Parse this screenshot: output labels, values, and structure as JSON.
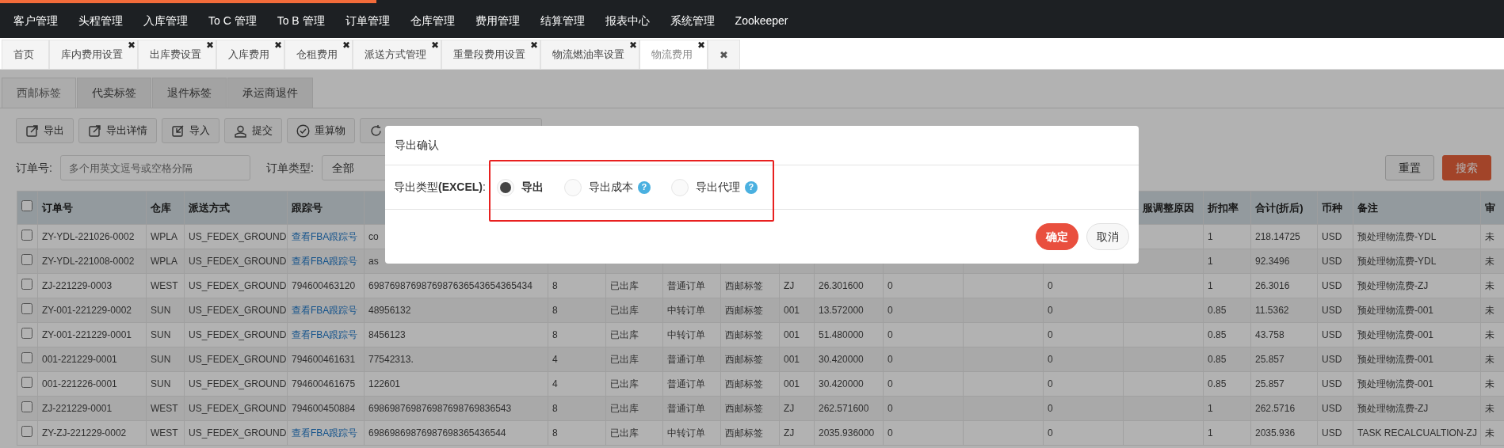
{
  "loading_bar": {
    "level": 0.25
  },
  "top_nav": {
    "items": [
      "客户管理",
      "头程管理",
      "入库管理",
      "To C 管理",
      "To B 管理",
      "订单管理",
      "仓库管理",
      "费用管理",
      "结算管理",
      "报表中心",
      "系统管理",
      "Zookeeper"
    ]
  },
  "page_tabs": [
    {
      "label": "首页",
      "selected": false
    },
    {
      "label": "库内费用设置",
      "selected": false,
      "close": "✖"
    },
    {
      "label": "出库费设置",
      "selected": false,
      "close": "✖"
    },
    {
      "label": "入库费用",
      "selected": false,
      "close": "✖"
    },
    {
      "label": "仓租费用",
      "selected": false,
      "close": "✖"
    },
    {
      "label": "派送方式管理",
      "selected": false,
      "close": "✖"
    },
    {
      "label": "重量段费用设置",
      "selected": false,
      "close": "✖"
    },
    {
      "label": "物流燃油率设置",
      "selected": false,
      "close": "✖"
    },
    {
      "label": "物流费用",
      "selected": true,
      "close": "✖"
    },
    {
      "close": "✖"
    }
  ],
  "sub_tabs": [
    {
      "label": "西邮标签",
      "selected": true
    },
    {
      "label": "代卖标签",
      "selected": false
    },
    {
      "label": "退件标签",
      "selected": false
    },
    {
      "label": "承运商退件",
      "selected": false
    }
  ],
  "toolbar": [
    {
      "label": "导出",
      "kind": "export"
    },
    {
      "label": "导出详情",
      "kind": "export"
    },
    {
      "label": "导入",
      "kind": "import"
    },
    {
      "label": "提交",
      "kind": "user"
    },
    {
      "label": "重算物",
      "kind": "check"
    },
    {
      "kind": "refresh"
    }
  ],
  "filters": [
    {
      "label": "订单号:",
      "kind": "text",
      "placeholder": "多个用英文逗号或空格分隔"
    },
    {
      "label": "订单类型:",
      "kind": "select",
      "value": "全部"
    }
  ],
  "filter_actions": [
    {
      "label": "重置",
      "kind": "default"
    },
    {
      "label": "搜索",
      "kind": "primary"
    }
  ],
  "table": {
    "select_all_checked": false,
    "columns": [
      "订单号",
      "仓库",
      "派送方式",
      "跟踪号",
      null,
      null,
      null,
      null,
      null,
      null,
      null,
      null,
      null,
      null,
      "服调整原因",
      "折扣率",
      "合计(折后)",
      "币种",
      "备注",
      "审"
    ],
    "rows": [
      {
        "checked": false,
        "cells": [
          "ZY-YDL-221026-0002",
          "WPLA",
          "US_FEDEX_GROUND",
          {
            "text": "查看FBA跟踪号",
            "kind": "link"
          },
          "co",
          null,
          null,
          null,
          null,
          null,
          null,
          null,
          null,
          null,
          null,
          "1",
          "218.14725",
          "USD",
          "预处理物流费-YDL",
          "未"
        ]
      },
      {
        "checked": false,
        "cells": [
          "ZY-YDL-221008-0002",
          "WPLA",
          "US_FEDEX_GROUND",
          {
            "text": "查看FBA跟踪号",
            "kind": "link"
          },
          "as",
          null,
          null,
          null,
          null,
          null,
          null,
          null,
          null,
          null,
          null,
          "1",
          "92.3496",
          "USD",
          "预处理物流费-YDL",
          "未"
        ]
      },
      {
        "checked": false,
        "cells": [
          "ZJ-221229-0003",
          "WEST",
          "US_FEDEX_GROUND",
          "794600463120",
          "6987698769876987636543654365434",
          "8",
          "已出库",
          "普通订单",
          "西邮标签",
          "ZJ",
          "26.301600",
          "0",
          null,
          "0",
          null,
          "1",
          "26.3016",
          "USD",
          "预处理物流费-ZJ",
          "未"
        ]
      },
      {
        "checked": false,
        "cells": [
          "ZY-001-221229-0002",
          "SUN",
          "US_FEDEX_GROUND",
          {
            "text": "查看FBA跟踪号",
            "kind": "link"
          },
          "48956132",
          "8",
          "已出库",
          "中转订单",
          "西邮标签",
          "001",
          "13.572000",
          "0",
          null,
          "0",
          null,
          "0.85",
          "11.5362",
          "USD",
          "预处理物流费-001",
          "未"
        ]
      },
      {
        "checked": false,
        "cells": [
          "ZY-001-221229-0001",
          "SUN",
          "US_FEDEX_GROUND",
          {
            "text": "查看FBA跟踪号",
            "kind": "link"
          },
          "8456123",
          "8",
          "已出库",
          "中转订单",
          "西邮标签",
          "001",
          "51.480000",
          "0",
          null,
          "0",
          null,
          "0.85",
          "43.758",
          "USD",
          "预处理物流费-001",
          "未"
        ]
      },
      {
        "checked": false,
        "cells": [
          "001-221229-0001",
          "SUN",
          "US_FEDEX_GROUND",
          "794600461631",
          "77542313.",
          "4",
          "已出库",
          "普通订单",
          "西邮标签",
          "001",
          "30.420000",
          "0",
          null,
          "0",
          null,
          "0.85",
          "25.857",
          "USD",
          "预处理物流费-001",
          "未"
        ]
      },
      {
        "checked": false,
        "cells": [
          "001-221226-0001",
          "SUN",
          "US_FEDEX_GROUND",
          "794600461675",
          "122601",
          "4",
          "已出库",
          "普通订单",
          "西邮标签",
          "001",
          "30.420000",
          "0",
          null,
          "0",
          null,
          "0.85",
          "25.857",
          "USD",
          "预处理物流费-001",
          "未"
        ]
      },
      {
        "checked": false,
        "cells": [
          "ZJ-221229-0001",
          "WEST",
          "US_FEDEX_GROUND",
          "794600450884",
          "698698769876987698769836543",
          "8",
          "已出库",
          "普通订单",
          "西邮标签",
          "ZJ",
          "262.571600",
          "0",
          null,
          "0",
          null,
          "1",
          "262.5716",
          "USD",
          "预处理物流费-ZJ",
          "未"
        ]
      },
      {
        "checked": false,
        "cells": [
          "ZY-ZJ-221229-0002",
          "WEST",
          "US_FEDEX_GROUND",
          {
            "text": "查看FBA跟踪号",
            "kind": "link"
          },
          "69869869876987698365436544",
          "8",
          "已出库",
          "中转订单",
          "西邮标签",
          "ZJ",
          "2035.936000",
          "0",
          null,
          "0",
          null,
          "1",
          "2035.936",
          "USD",
          "TASK RECALCUALTION-ZJ",
          "未"
        ]
      }
    ]
  },
  "dialog": {
    "title": "导出确认",
    "label": "导出类型**(EXCEL)**:",
    "options": [
      {
        "label": "导出",
        "selected": true
      },
      {
        "label": "导出成本",
        "selected": false,
        "help": "?"
      },
      {
        "label": "导出代理",
        "selected": false,
        "help": "?"
      }
    ],
    "buttons": [
      {
        "label": "确定",
        "kind": "primary"
      },
      {
        "label": "取消",
        "kind": "default"
      }
    ]
  }
}
